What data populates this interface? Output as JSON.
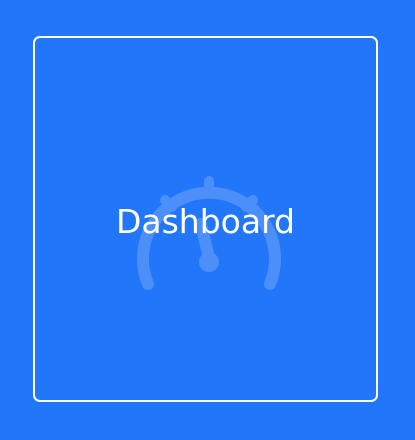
{
  "tile": {
    "label": "Dashboard",
    "icon": "gauge-icon"
  },
  "colors": {
    "background": "#2176fa",
    "border": "#ffffff",
    "text": "#ffffff",
    "icon": "#4c8ff9"
  }
}
